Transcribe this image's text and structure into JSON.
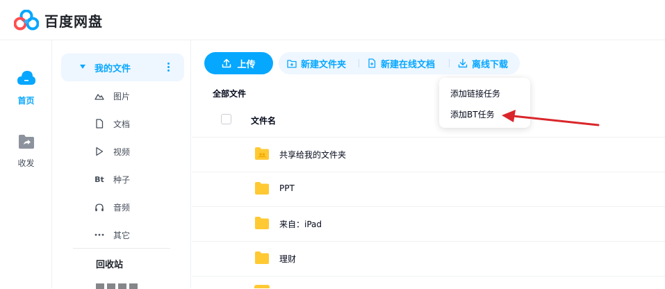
{
  "app": {
    "title": "百度网盘"
  },
  "rail": {
    "home_label": "首页",
    "share_label": "收发"
  },
  "sidebar": {
    "main_label": "我的文件",
    "items": [
      {
        "label": "图片",
        "icon": "mountain-icon"
      },
      {
        "label": "文档",
        "icon": "document-icon"
      },
      {
        "label": "视频",
        "icon": "play-icon"
      },
      {
        "label": "种子",
        "icon": "Bt"
      },
      {
        "label": "音频",
        "icon": "headphones-icon"
      },
      {
        "label": "其它",
        "icon": "more-dots-icon"
      }
    ],
    "recycle_label": "回收站"
  },
  "toolbar": {
    "upload_label": "上传",
    "new_folder_label": "新建文件夹",
    "new_online_doc_label": "新建在线文档",
    "offline_download_label": "离线下载"
  },
  "breadcrumb": "全部文件",
  "table": {
    "header_name": "文件名",
    "rows": [
      {
        "name": "共享给我的文件夹",
        "type": "shared-folder"
      },
      {
        "name": "PPT",
        "type": "folder"
      },
      {
        "name": "来自：iPad",
        "type": "folder"
      },
      {
        "name": "理财",
        "type": "folder"
      }
    ]
  },
  "dropdown": {
    "items": [
      "添加链接任务",
      "添加BT任务"
    ]
  },
  "colors": {
    "accent": "#06a7ff",
    "accent_bg": "#eef6ff",
    "folder": "#ffc933",
    "arrow": "#d9262b"
  }
}
